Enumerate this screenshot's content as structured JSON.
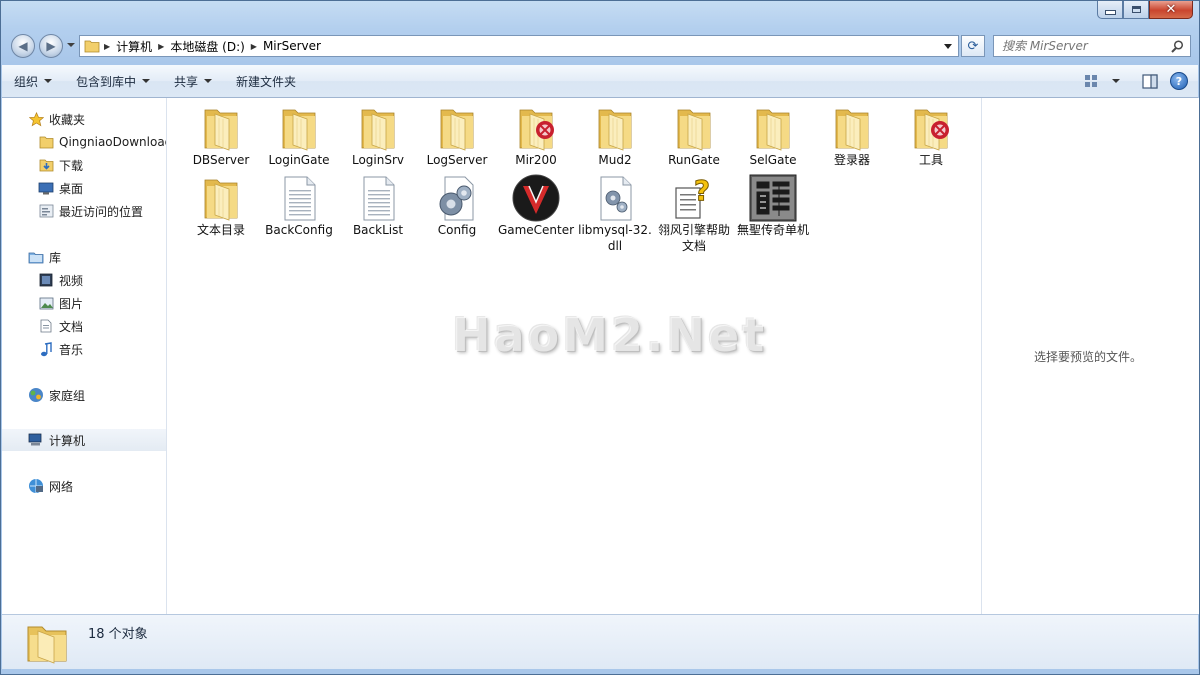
{
  "window": {
    "caption_buttons": [
      "minimize-icon",
      "maximize-icon",
      "close-icon"
    ]
  },
  "nav": {
    "back_icon": "back-arrow-icon",
    "forward_icon": "forward-arrow-icon",
    "breadcrumb": [
      "计算机",
      "本地磁盘 (D:)",
      "MirServer"
    ],
    "search_placeholder": "搜索 MirServer"
  },
  "toolbar": {
    "organize": "组织",
    "include_in_library": "包含到库中",
    "share": "共享",
    "new_folder": "新建文件夹"
  },
  "sidebar": {
    "favorites_label": "收藏夹",
    "favorites": [
      "QingniaoDownloads",
      "下载",
      "桌面",
      "最近访问的位置"
    ],
    "libraries_label": "库",
    "libraries": [
      "视频",
      "图片",
      "文档",
      "音乐"
    ],
    "homegroup": "家庭组",
    "computer": "计算机",
    "network": "网络"
  },
  "files": [
    {
      "name": "DBServer",
      "type": "folder"
    },
    {
      "name": "LoginGate",
      "type": "folder"
    },
    {
      "name": "LoginSrv",
      "type": "folder"
    },
    {
      "name": "LogServer",
      "type": "folder"
    },
    {
      "name": "Mir200",
      "type": "folder-red"
    },
    {
      "name": "Mud2",
      "type": "folder"
    },
    {
      "name": "RunGate",
      "type": "folder"
    },
    {
      "name": "SelGate",
      "type": "folder"
    },
    {
      "name": "登录器",
      "type": "folder"
    },
    {
      "name": "工具",
      "type": "folder-red"
    },
    {
      "name": "文本目录",
      "type": "folder"
    },
    {
      "name": "BackConfig",
      "type": "document"
    },
    {
      "name": "BackList",
      "type": "document"
    },
    {
      "name": "Config",
      "type": "config"
    },
    {
      "name": "GameCenter",
      "type": "gamecenter"
    },
    {
      "name": "libmysql-32.dll",
      "type": "dll"
    },
    {
      "name": "翎风引擎帮助文档",
      "type": "help"
    },
    {
      "name": "無聖传奇单机",
      "type": "dragon"
    }
  ],
  "watermark": "HaoM2.Net",
  "preview": {
    "message": "选择要预览的文件。"
  },
  "status": {
    "item_count": "18 个对象"
  },
  "colors": {
    "folder": "#f2d57e",
    "accent": "#2a5d9a",
    "close": "#c9452e"
  }
}
